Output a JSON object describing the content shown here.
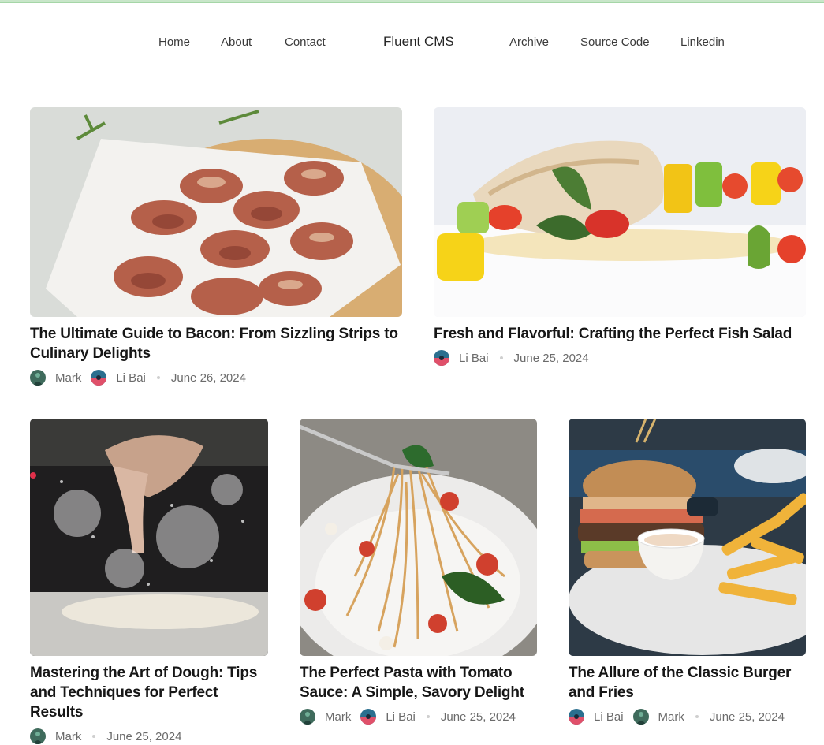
{
  "nav": {
    "left": [
      "Home",
      "About",
      "Contact"
    ],
    "brand": "Fluent CMS",
    "right": [
      "Archive",
      "Source Code",
      "Linkedin"
    ]
  },
  "posts": [
    {
      "title": "The Ultimate Guide to Bacon: From Sizzling Strips to Culinary Delights",
      "authors": [
        "Mark",
        "Li Bai"
      ],
      "date": "June 26, 2024",
      "image": "bacon-skewers"
    },
    {
      "title": "Fresh and Flavorful: Crafting the Perfect Fish Salad",
      "authors": [
        "Li Bai"
      ],
      "date": "June 25, 2024",
      "image": "fish-salad"
    },
    {
      "title": "Mastering the Art of Dough: Tips and Techniques for Perfect Results",
      "authors": [
        "Mark"
      ],
      "date": "June 25, 2024",
      "image": "flour-dough"
    },
    {
      "title": "The Perfect Pasta with Tomato Sauce: A Simple, Savory Delight",
      "authors": [
        "Mark",
        "Li Bai"
      ],
      "date": "June 25, 2024",
      "image": "pasta-fork"
    },
    {
      "title": "The Allure of the Classic Burger and Fries",
      "authors": [
        "Li Bai",
        "Mark"
      ],
      "date": "June 25, 2024",
      "image": "burger-fries"
    }
  ],
  "colors": {
    "accent_bar": "#c8e6c9",
    "text": "#161616",
    "muted": "#6b6b6b"
  }
}
